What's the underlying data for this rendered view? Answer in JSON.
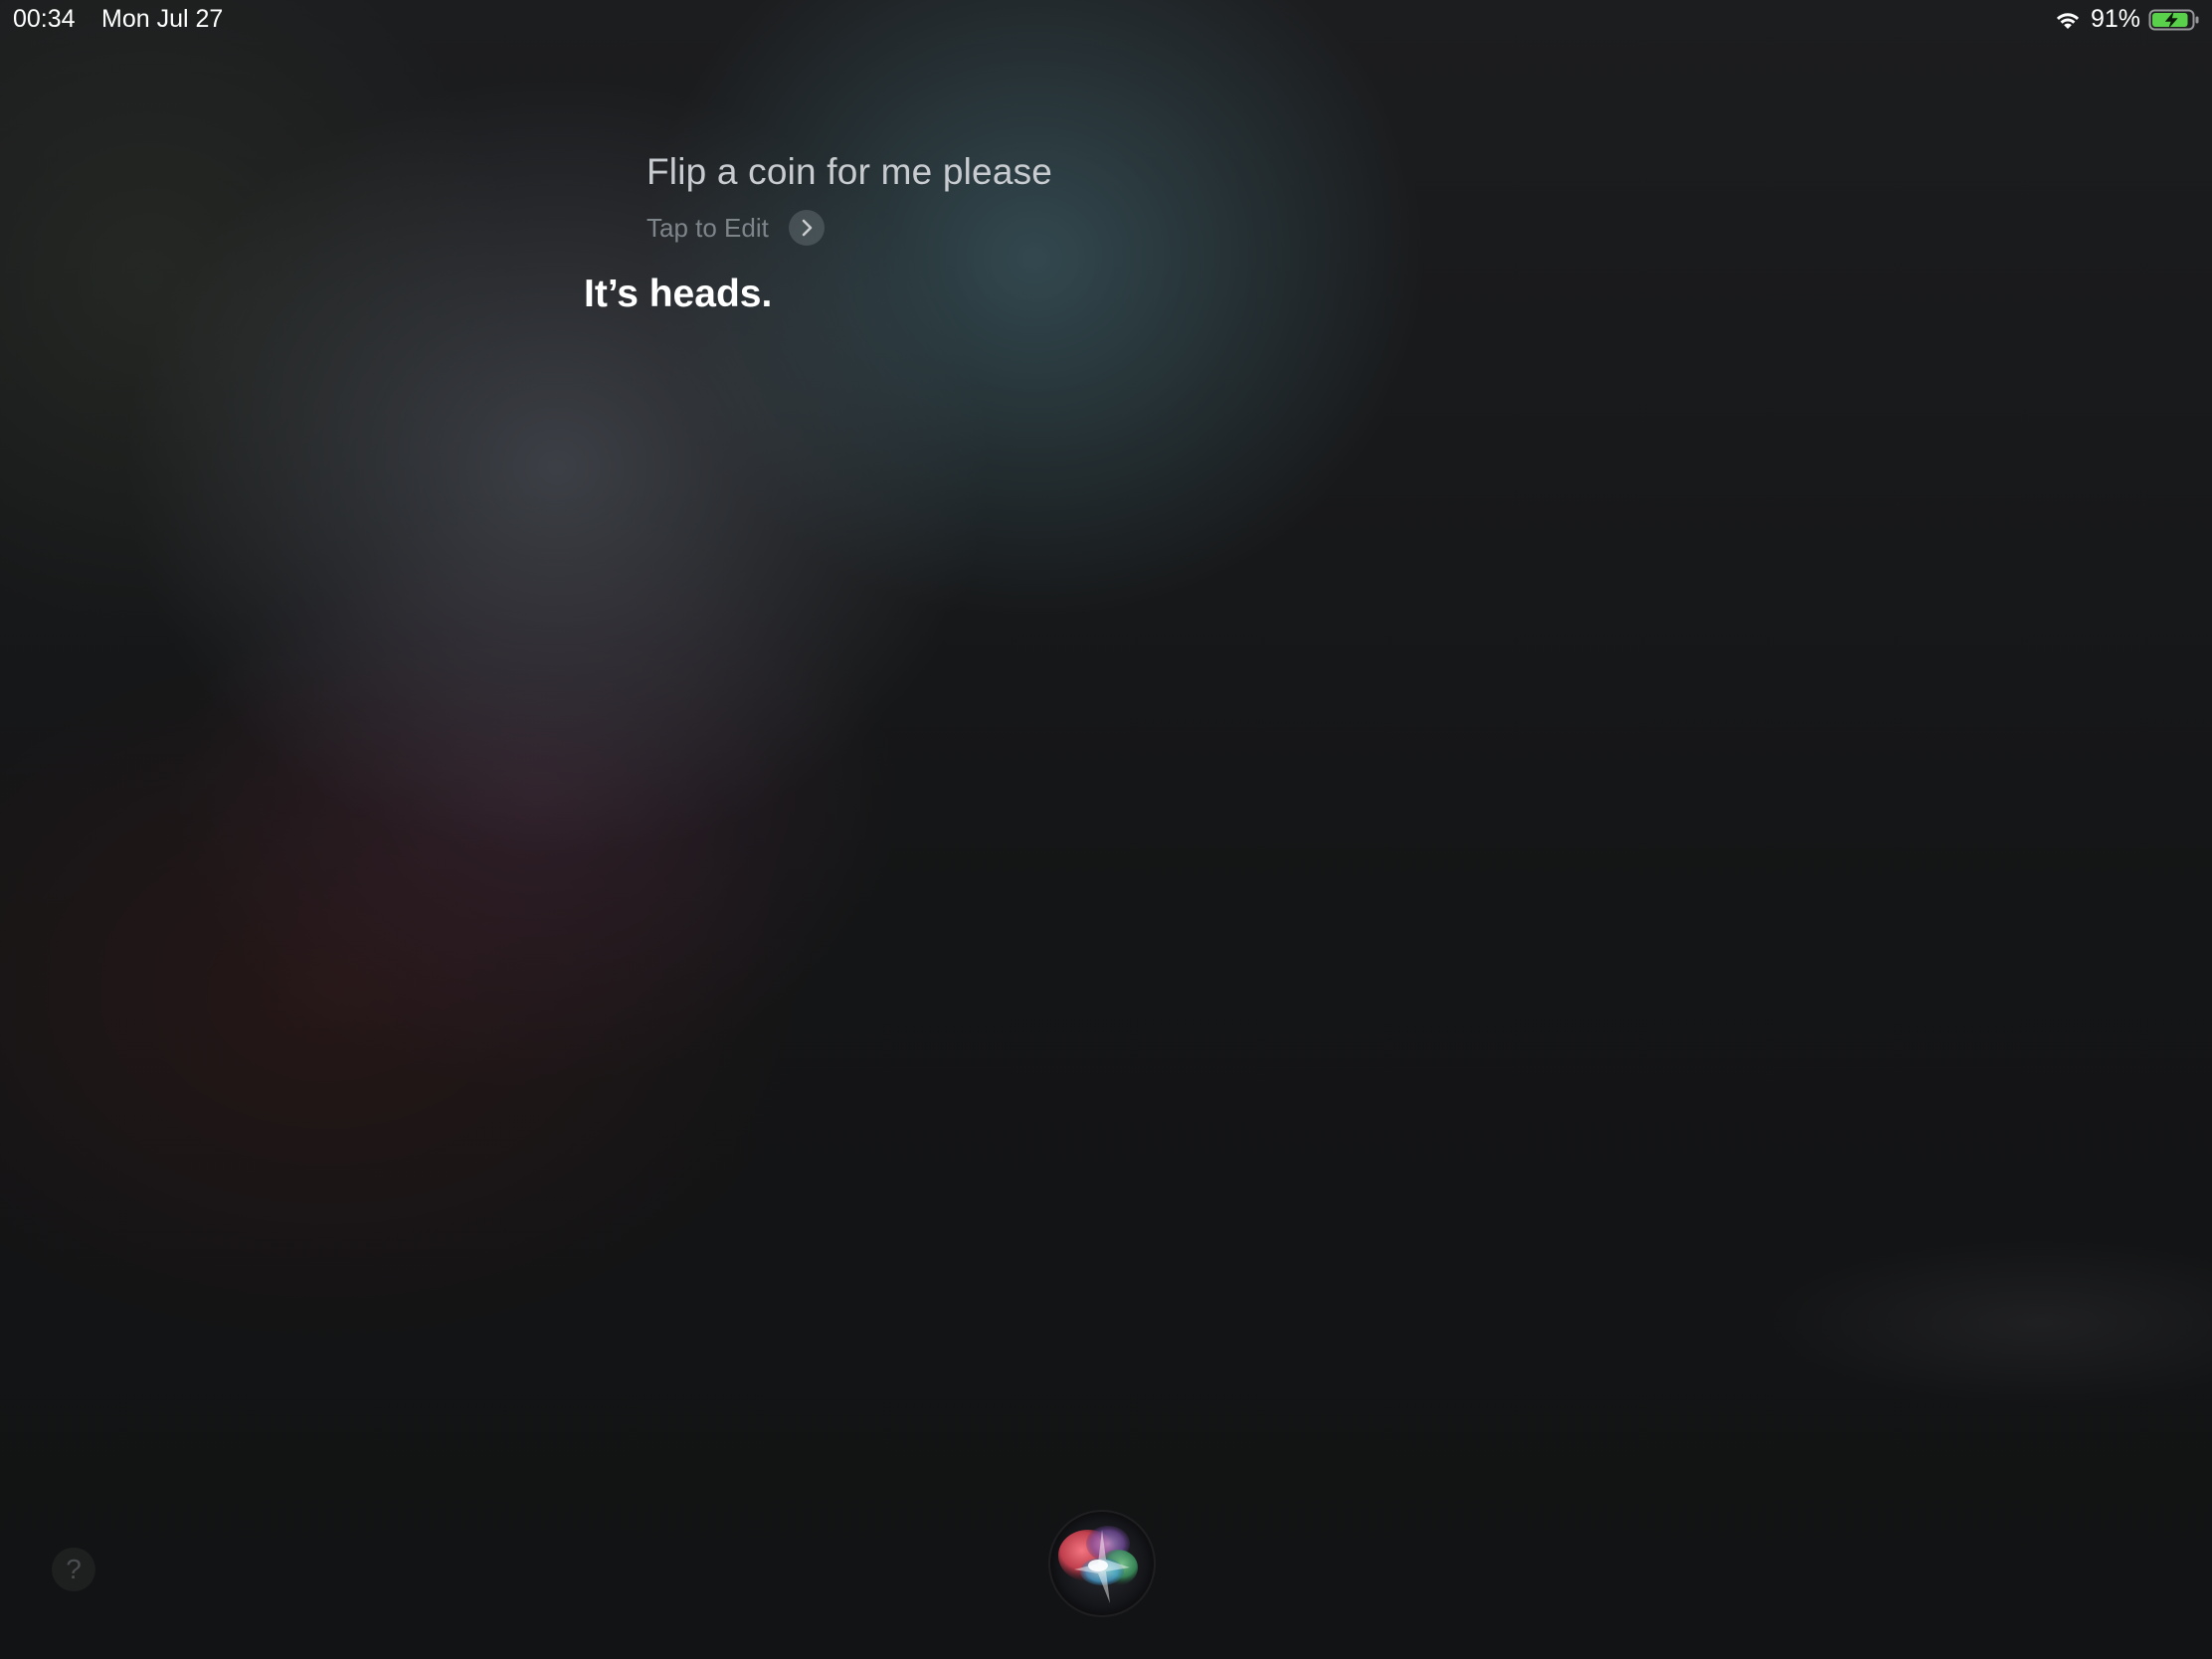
{
  "status_bar": {
    "time": "00:34",
    "date": "Mon Jul 27",
    "battery_percent_label": "91%",
    "battery_level": 0.91,
    "battery_color": "#5ad14a",
    "wifi_icon": "wifi-icon",
    "battery_icon": "battery-charging-icon"
  },
  "siri": {
    "user_query": "Flip a coin for me please",
    "edit_label": "Tap to Edit",
    "edit_icon": "chevron-right-icon",
    "response": "It’s heads."
  },
  "controls": {
    "help_label": "?",
    "siri_orb_icon": "siri-orb-icon"
  }
}
